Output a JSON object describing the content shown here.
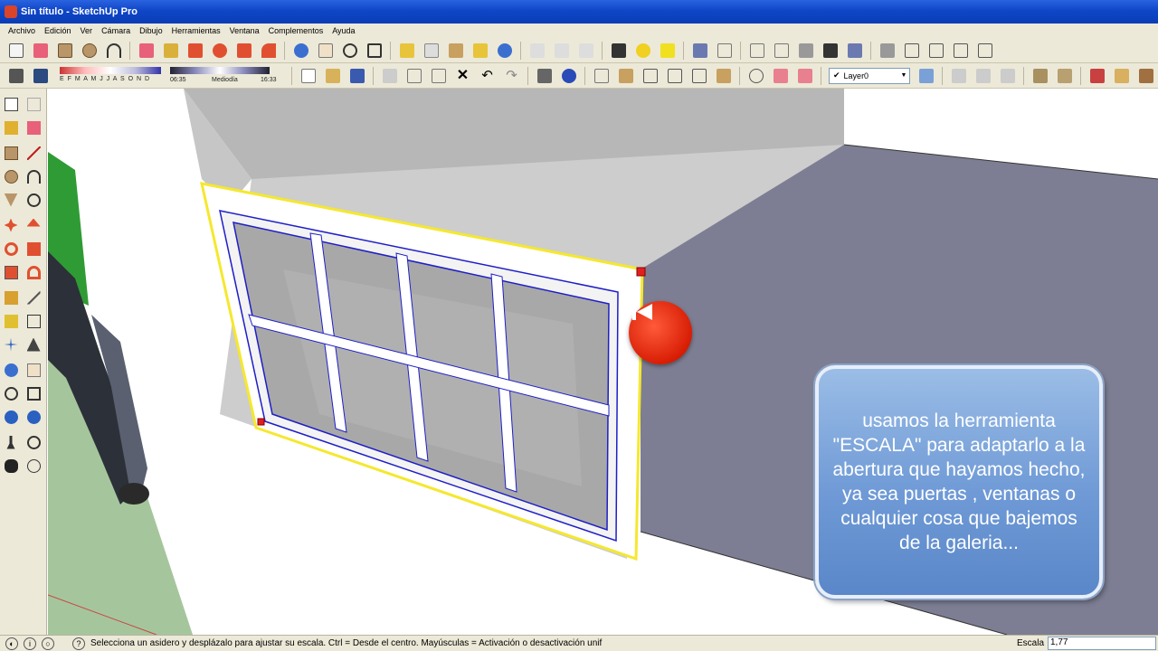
{
  "window": {
    "title": "Sin título - SketchUp Pro"
  },
  "menu": [
    "Archivo",
    "Edición",
    "Ver",
    "Cámara",
    "Dibujo",
    "Herramientas",
    "Ventana",
    "Complementos",
    "Ayuda"
  ],
  "shadows": {
    "months": "E F M A M J J A S O N D",
    "time_start": "06:35",
    "time_mid": "Mediodía",
    "time_end": "16:33"
  },
  "layer": {
    "current": "Layer0"
  },
  "overlay": {
    "tip_text": "usamos la herramienta \"ESCALA\" para adaptarlo a la abertura que hayamos hecho, ya sea puertas , ventanas o cualquier cosa que bajemos de la galeria..."
  },
  "status": {
    "message": "Selecciona un asidero y desplázalo para ajustar su escala. Ctrl = Desde el centro. Mayúsculas = Activación o desactivación unif",
    "vcb_label": "Escala",
    "vcb_value": "1,77"
  },
  "icons": {
    "toolbar_1": [
      "select-icon",
      "eraser-icon",
      "rectangle-icon",
      "circle-icon",
      "arc-icon",
      "paint-bucket-icon",
      "push-pull-icon",
      "move-icon",
      "rotate-icon",
      "scale-icon",
      "offset-icon",
      "orbit-icon",
      "pan-icon",
      "zoom-icon",
      "zoom-extents-icon",
      "tape-measure-icon",
      "protractor-icon",
      "axes-icon",
      "dimension-icon",
      "text-icon",
      "walk-icon",
      "look-around-icon",
      "help-icon",
      "info-icon",
      "iso-view-icon",
      "top-view-icon",
      "front-view-icon",
      "right-view-icon",
      "back-view-icon",
      "left-view-icon",
      "xray-icon",
      "wireframe-icon",
      "hidden-line-icon",
      "shaded-icon",
      "textured-icon",
      "monochrome-icon",
      "section-plane-icon",
      "section-cut-icon",
      "components-icon",
      "materials-icon",
      "outliner-icon"
    ],
    "toolbar_2": [
      "shadow-toggle-icon",
      "fog-icon",
      "new-icon",
      "open-icon",
      "save-icon",
      "cut-icon",
      "copy-icon",
      "paste-icon",
      "delete-icon",
      "undo-icon",
      "redo-icon",
      "print-icon",
      "model-info-icon",
      "warehouse-icon",
      "share-icon",
      "home-icon",
      "house-icon",
      "fence-icon",
      "roof-icon",
      "window-icon",
      "door-icon",
      "layer-manager-icon",
      "sandbox-icon",
      "terrain-icon",
      "stamp-icon",
      "drape-icon",
      "add-detail-icon",
      "flip-edge-icon",
      "texture-icon",
      "photo-icon",
      "geo-icon"
    ],
    "left_tools": [
      "select-icon",
      "make-component-icon",
      "paint-bucket-icon",
      "eraser-icon",
      "rectangle-icon",
      "line-icon",
      "circle-icon",
      "arc-icon",
      "polygon-icon",
      "freehand-icon",
      "move-icon",
      "push-pull-icon",
      "rotate-icon",
      "follow-me-icon",
      "scale-icon",
      "offset-icon",
      "tape-measure-icon",
      "dimension-icon",
      "protractor-icon",
      "text-icon",
      "axes-icon",
      "3d-text-icon",
      "orbit-icon",
      "pan-icon",
      "zoom-icon",
      "zoom-window-icon",
      "previous-view-icon",
      "next-view-icon",
      "position-camera-icon",
      "look-around-icon",
      "walk-icon",
      "section-plane-icon"
    ],
    "status": [
      "geo-location-icon",
      "credits-icon",
      "user-icon",
      "help-icon"
    ],
    "overlay": "rewind-icon"
  },
  "colors": {
    "title_bar": "#0f46c8",
    "selection": "#f5e82e",
    "edge_selected": "#1e1ec8",
    "tip_box": "#6f9ad6",
    "rewind_button": "#d81e05"
  }
}
